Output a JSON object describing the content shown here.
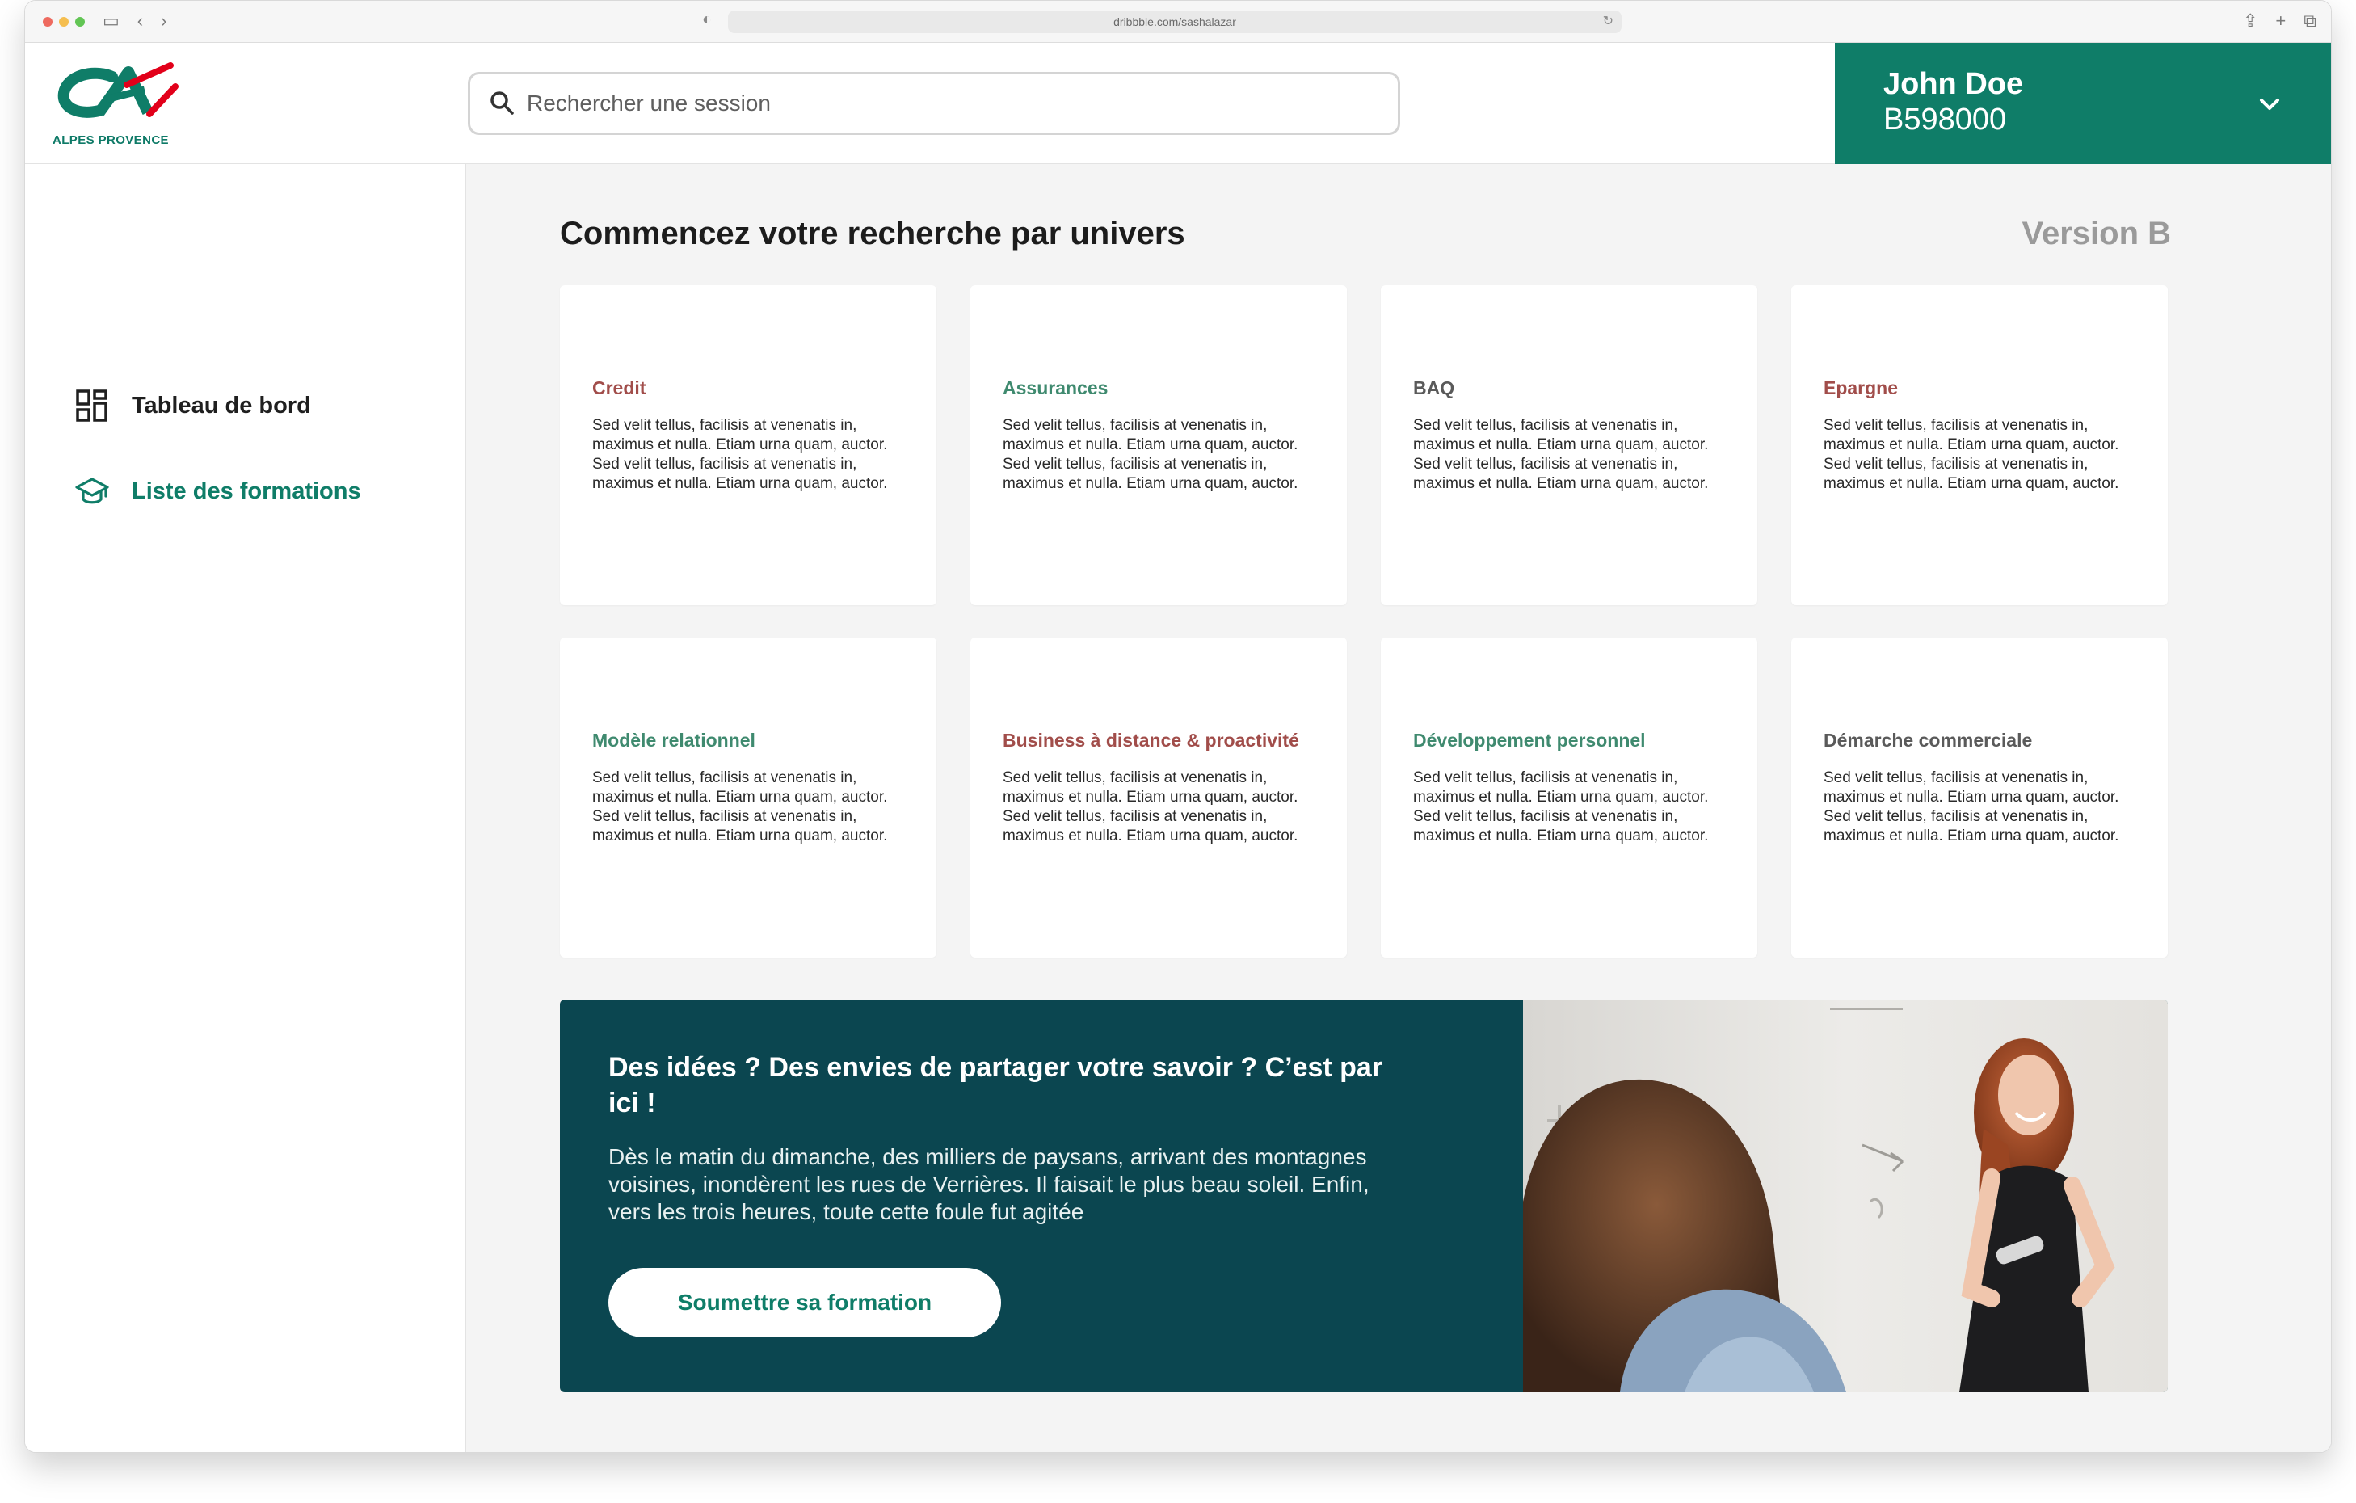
{
  "browser": {
    "url": "dribbble.com/sashalazar"
  },
  "brand": {
    "logo_text": "ALPES PROVENCE",
    "color_primary": "#0f7d68",
    "color_red": "#e2001a",
    "color_dark_teal": "#0b4650"
  },
  "search": {
    "placeholder": "Rechercher une session",
    "value": ""
  },
  "user": {
    "name": "John Doe",
    "id": "B598000"
  },
  "sidebar": {
    "items": [
      {
        "label": "Tableau de bord",
        "icon": "dashboard-icon",
        "active": false
      },
      {
        "label": "Liste des formations",
        "icon": "graduation-cap-icon",
        "active": true
      }
    ]
  },
  "main": {
    "title": "Commencez votre recherche par univers",
    "version": "Version B",
    "cards": [
      {
        "title": "Credit",
        "color": "#a14d4a",
        "text": "Sed velit tellus, facilisis at venenatis in, maximus et nulla. Etiam urna quam, auctor. Sed velit tellus, facilisis at venenatis in, maximus et nulla. Etiam urna quam, auctor."
      },
      {
        "title": "Assurances",
        "color": "#3f8a6f",
        "text": "Sed velit tellus, facilisis at venenatis in, maximus et nulla. Etiam urna quam, auctor. Sed velit tellus, facilisis at venenatis in, maximus et nulla. Etiam urna quam, auctor."
      },
      {
        "title": "BAQ",
        "color": "#5a5a5a",
        "text": "Sed velit tellus, facilisis at venenatis in, maximus et nulla. Etiam urna quam, auctor. Sed velit tellus, facilisis at venenatis in, maximus et nulla. Etiam urna quam, auctor."
      },
      {
        "title": "Epargne",
        "color": "#a14d4a",
        "text": "Sed velit tellus, facilisis at venenatis in, maximus et nulla. Etiam urna quam, auctor. Sed velit tellus, facilisis at venenatis in, maximus et nulla. Etiam urna quam, auctor."
      },
      {
        "title": "Modèle relationnel",
        "color": "#3f8a6f",
        "text": "Sed velit tellus, facilisis at venenatis in, maximus et nulla. Etiam urna quam, auctor. Sed velit tellus, facilisis at venenatis in, maximus et nulla. Etiam urna quam, auctor."
      },
      {
        "title": "Business à distance & proactivité",
        "color": "#a14d4a",
        "text": "Sed velit tellus, facilisis at venenatis in, maximus et nulla. Etiam urna quam, auctor. Sed velit tellus, facilisis at venenatis in, maximus et nulla. Etiam urna quam, auctor."
      },
      {
        "title": "Développement personnel",
        "color": "#3f8a6f",
        "text": "Sed velit tellus, facilisis at venenatis in, maximus et nulla. Etiam urna quam, auctor. Sed velit tellus, facilisis at venenatis in, maximus et nulla. Etiam urna quam, auctor."
      },
      {
        "title": "Démarche commerciale",
        "color": "#5a5a5a",
        "text": "Sed velit tellus, facilisis at venenatis in, maximus et nulla. Etiam urna quam, auctor. Sed velit tellus, facilisis at venenatis in, maximus et nulla. Etiam urna quam, auctor."
      }
    ]
  },
  "banner": {
    "title": "Des idées ? Des envies de partager votre savoir ? C’est par ici !",
    "text": "Dès le matin du dimanche, des milliers de paysans, arrivant des montagnes voisines, inondèrent les rues de Verrières. Il faisait le plus beau soleil. Enfin, vers les trois heures, toute cette foule fut agitée",
    "button_label": "Soumettre sa formation",
    "photo": "classroom-photo"
  }
}
